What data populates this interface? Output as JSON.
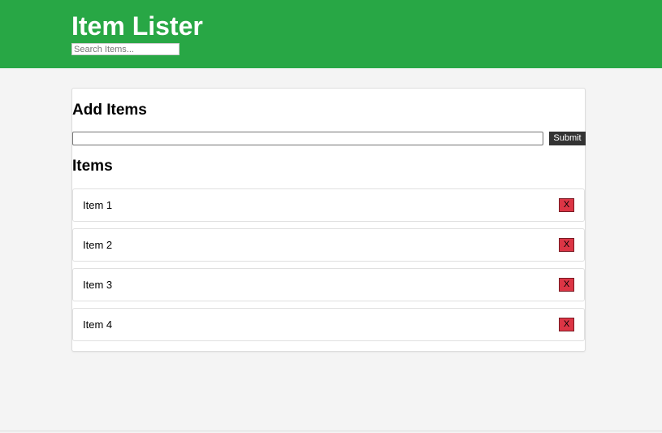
{
  "header": {
    "title": "Item Lister",
    "search_placeholder": "Search Items..."
  },
  "add_section": {
    "title": "Add Items",
    "input_value": "",
    "submit_label": "Submit"
  },
  "items_section": {
    "title": "Items",
    "delete_label": "X",
    "items": [
      {
        "label": "Item 1"
      },
      {
        "label": "Item 2"
      },
      {
        "label": "Item 3"
      },
      {
        "label": "Item 4"
      }
    ]
  },
  "colors": {
    "header_bg": "#28a745",
    "delete_bg": "#dc3545",
    "submit_bg": "#333333"
  }
}
